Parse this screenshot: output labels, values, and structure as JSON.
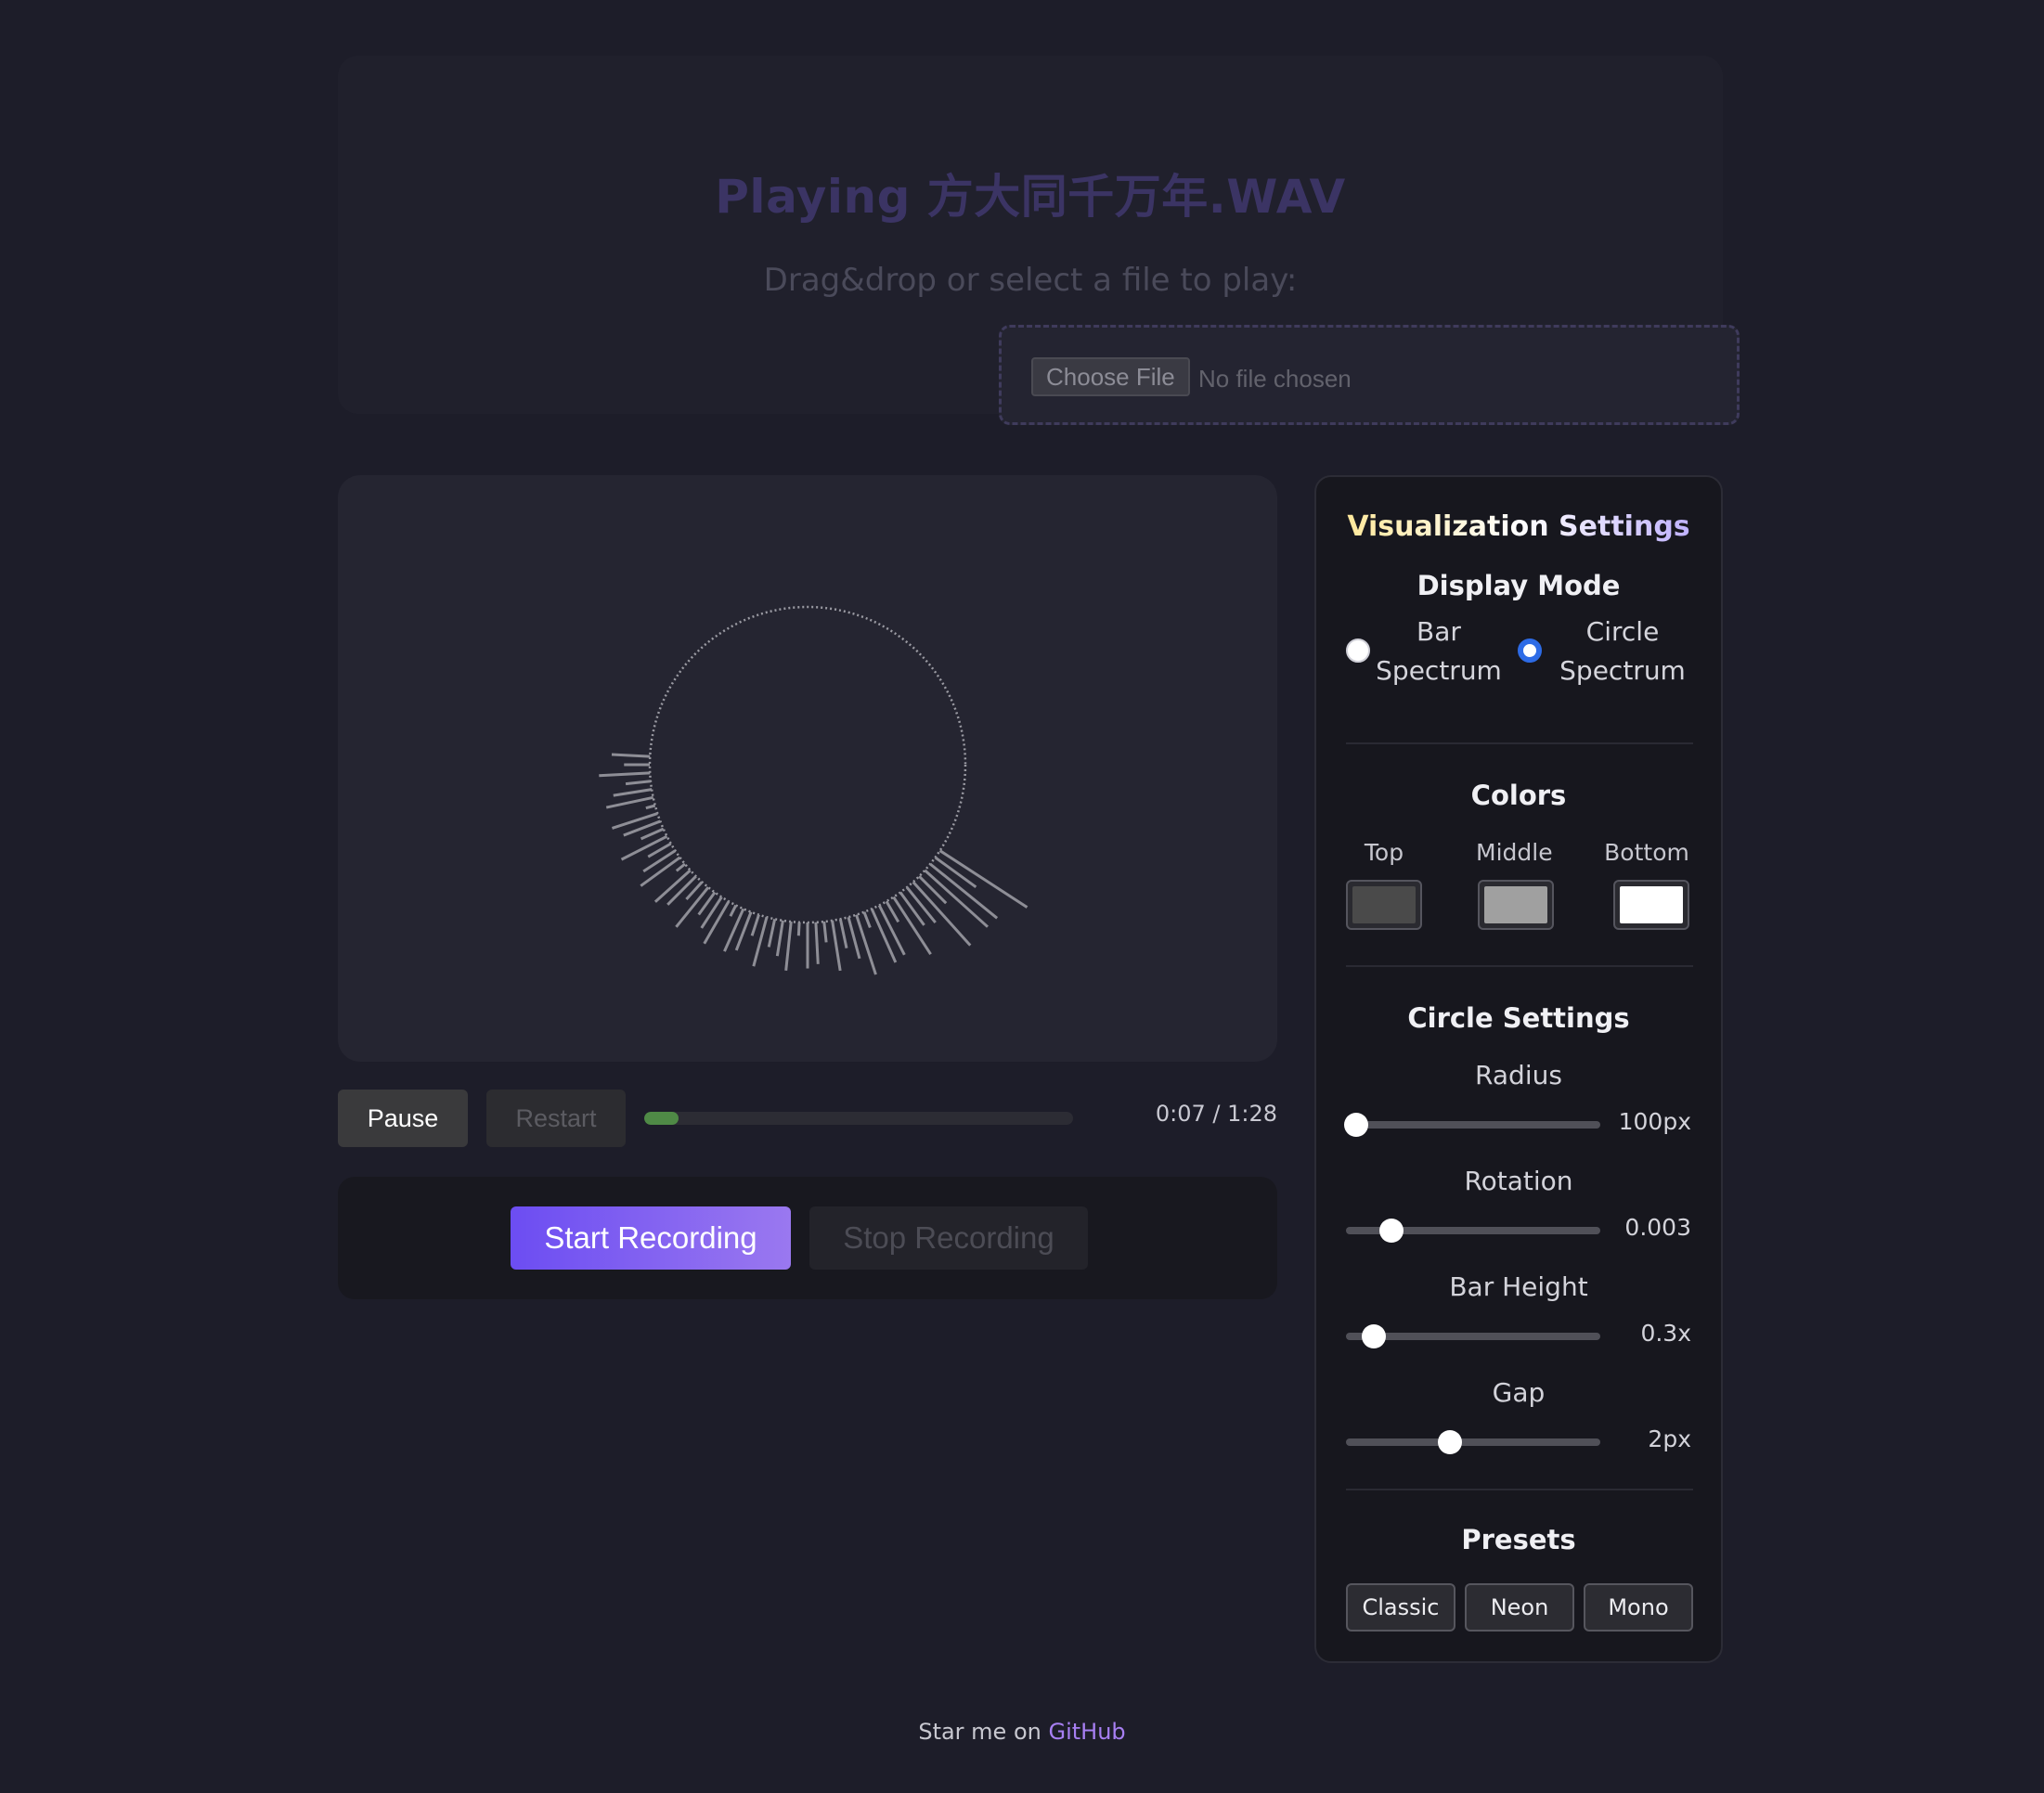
{
  "header": {
    "title": "Playing 方大同千万年.WAV",
    "subtitle": "Drag&drop or select a file to play:",
    "file_button": "Choose File",
    "file_status": "No file chosen"
  },
  "playback": {
    "pause_label": "Pause",
    "restart_label": "Restart",
    "progress_fraction": 0.08,
    "time": "0:07 / 1:28"
  },
  "recording": {
    "start_label": "Start Recording",
    "stop_label": "Stop Recording"
  },
  "settings": {
    "title": "Visualization Settings",
    "display_mode": {
      "title": "Display Mode",
      "options": [
        {
          "label": "Bar Spectrum",
          "checked": false
        },
        {
          "label": "Circle Spectrum",
          "checked": true
        }
      ]
    },
    "colors": {
      "title": "Colors",
      "items": [
        {
          "label": "Top",
          "value": "#4a4a4a"
        },
        {
          "label": "Middle",
          "value": "#a0a0a0"
        },
        {
          "label": "Bottom",
          "value": "#ffffff"
        }
      ]
    },
    "circle_settings": {
      "title": "Circle Settings",
      "sliders": [
        {
          "label": "Radius",
          "value": "100px",
          "fraction": 0.04
        },
        {
          "label": "Rotation",
          "value": "0.003",
          "fraction": 0.18
        },
        {
          "label": "Bar Height",
          "value": "0.3x",
          "fraction": 0.11
        },
        {
          "label": "Gap",
          "value": "2px",
          "fraction": 0.41
        }
      ]
    },
    "presets": {
      "title": "Presets",
      "buttons": [
        "Classic",
        "Neon",
        "Mono"
      ]
    }
  },
  "footer": {
    "text": "Star me on",
    "link": "GitHub"
  },
  "theme": {
    "accent": "#7c5cf0",
    "progress": "#4f8a46",
    "radio_checked": "#2d6be6"
  }
}
